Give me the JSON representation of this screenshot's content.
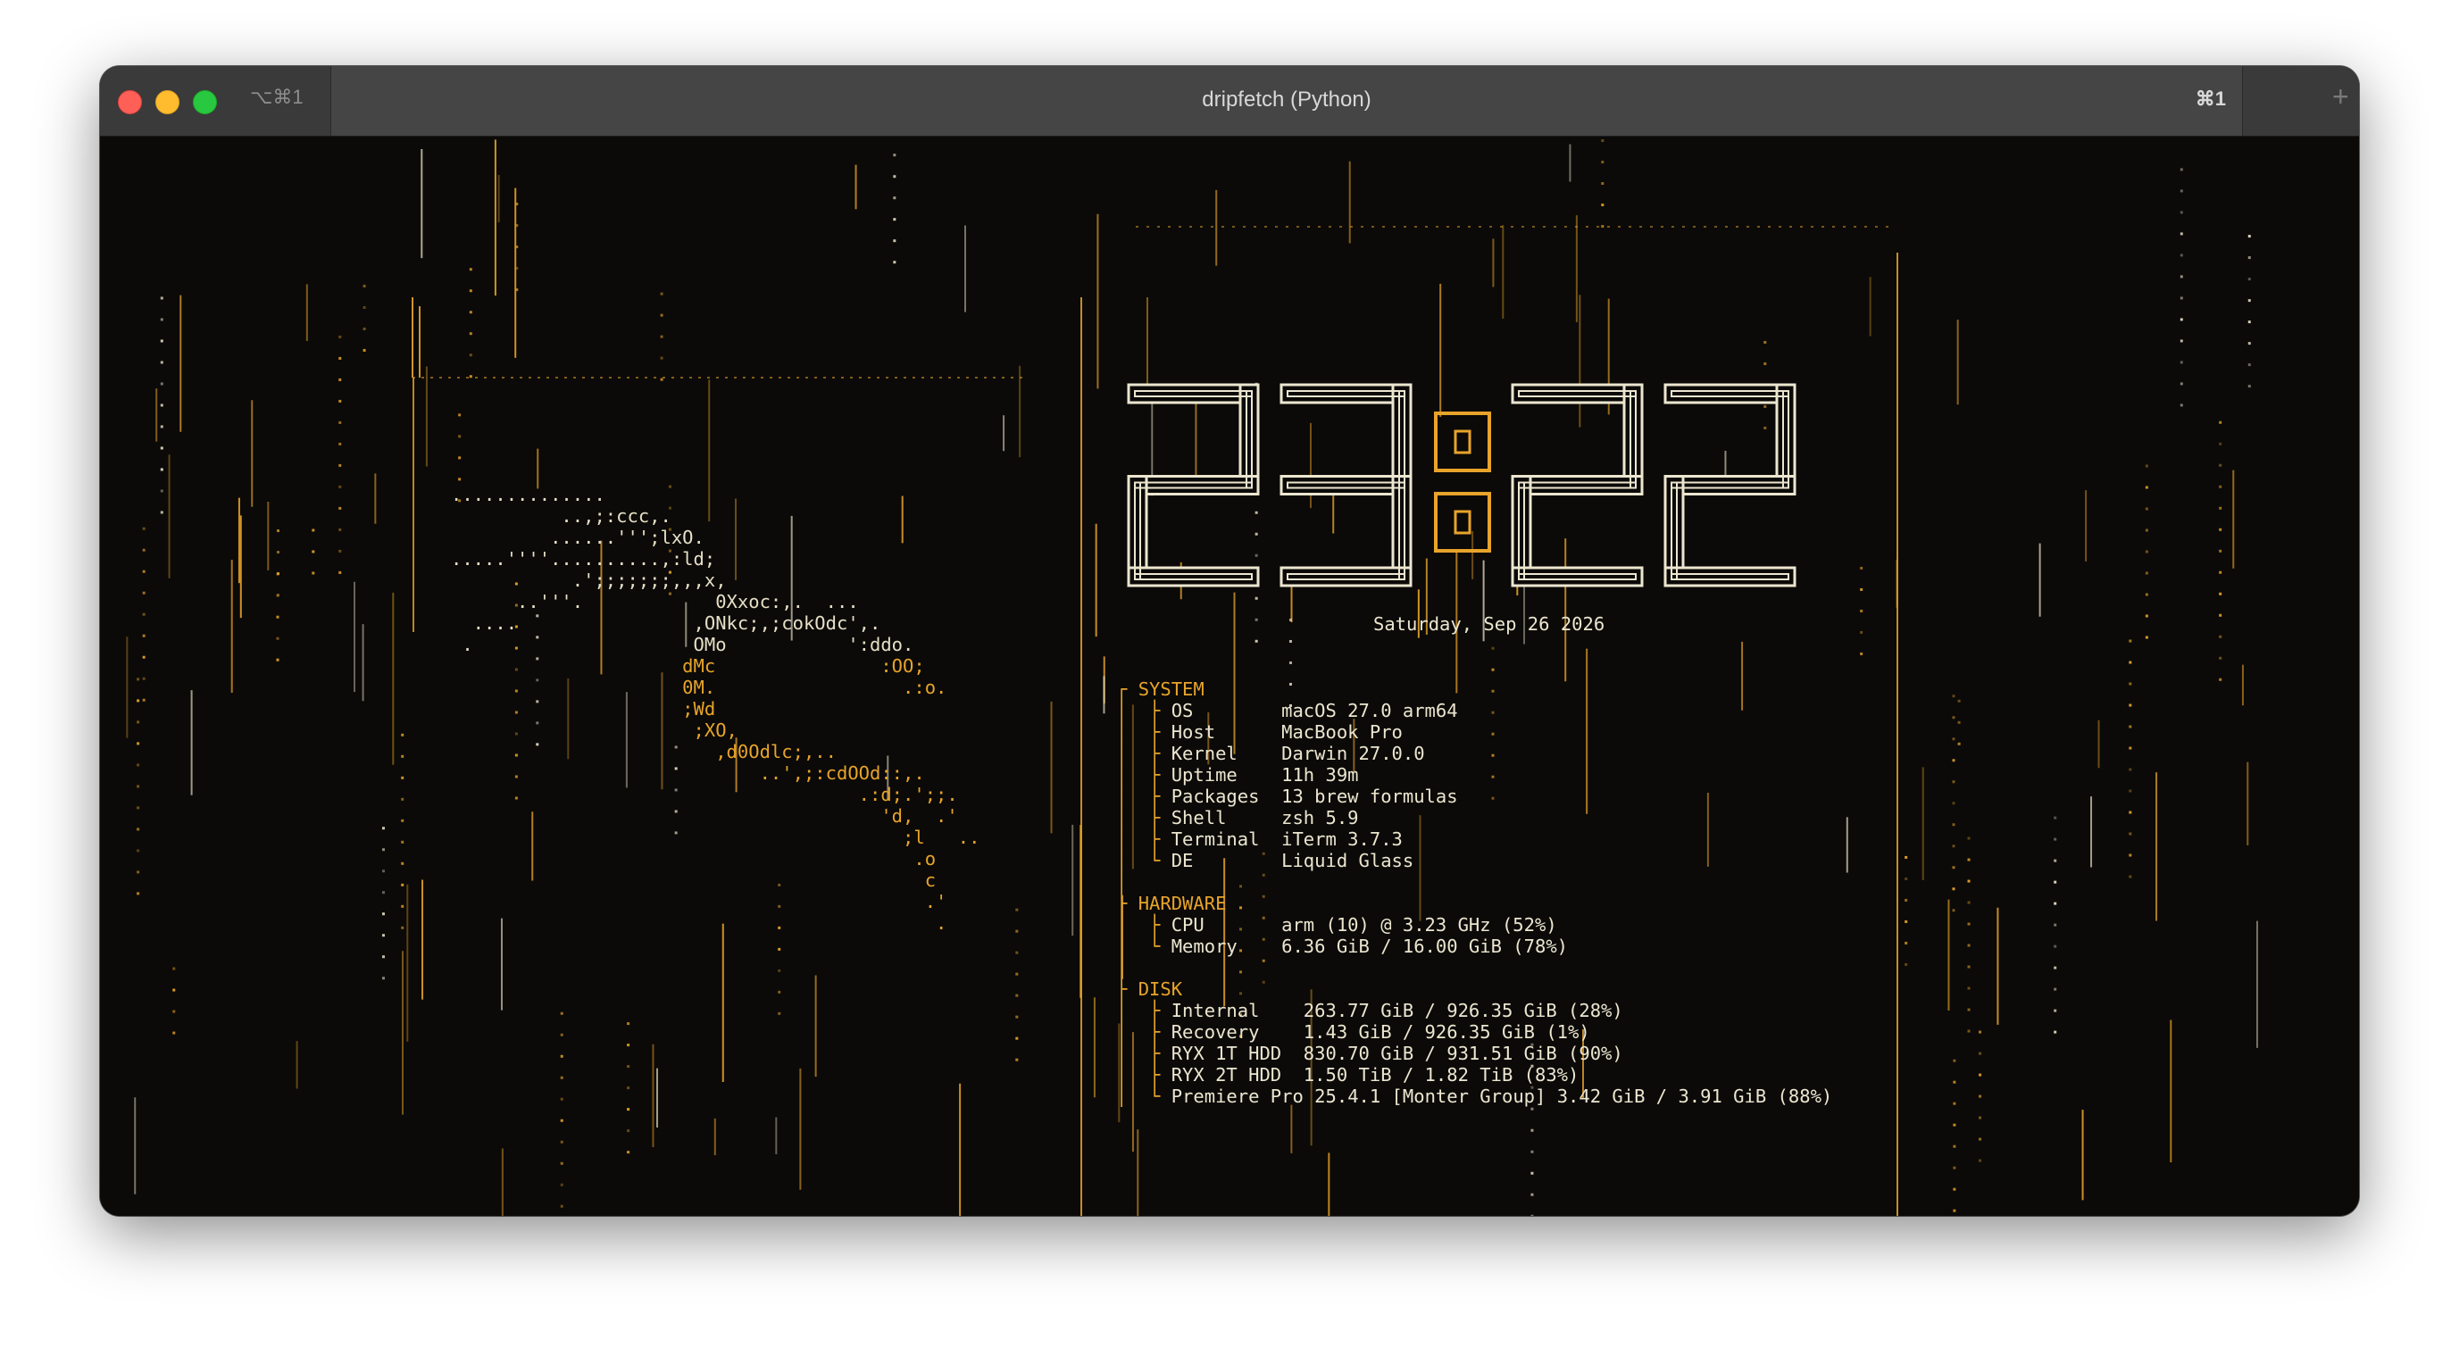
{
  "window": {
    "title": "dripfetch (Python)",
    "left_shortcut": "⌥⌘1",
    "right_shortcut": "⌘1",
    "new_tab_label": "+"
  },
  "colors": {
    "accent": "#e8a42a",
    "text": "#ece6d0",
    "background": "#0b0a08"
  },
  "clock": {
    "time": "23:22"
  },
  "date": "Saturday, Sep 26 2026",
  "ascii_art": [
    {
      "text": "..............",
      "amber": false
    },
    {
      "text": "          ..,;:ccc,.",
      "amber": false
    },
    {
      "text": "         ......''';lxO.",
      "amber": false
    },
    {
      "text": ".....''''..........,:ld;",
      "amber": false
    },
    {
      "text": "           .';;;;;;;,,,x,",
      "amber": false
    },
    {
      "text": "      ..'''.            0Xxoc:,.  ...",
      "amber": false
    },
    {
      "text": "  ....                ,ONkc;,;cokOdc',.",
      "amber": false
    },
    {
      "text": " .                    OMo           ':ddo.",
      "amber": false
    },
    {
      "text": "                     dMc               :OO;",
      "amber": true
    },
    {
      "text": "                     0M.                 .:o.",
      "amber": true
    },
    {
      "text": "                     ;Wd",
      "amber": true
    },
    {
      "text": "                      ;XO,",
      "amber": true
    },
    {
      "text": "                        ,d0Odlc;,..",
      "amber": true
    },
    {
      "text": "                            ..',;:cdOOd::,.",
      "amber": true
    },
    {
      "text": "                                     .:d;.';;.",
      "amber": true
    },
    {
      "text": "                                       'd,  .'",
      "amber": true
    },
    {
      "text": "                                         ;l   ..",
      "amber": true
    },
    {
      "text": "                                          .o",
      "amber": true
    },
    {
      "text": "                                           c",
      "amber": true
    },
    {
      "text": "                                           .'",
      "amber": true
    },
    {
      "text": "                                            .",
      "amber": true
    }
  ],
  "sections": [
    {
      "title": "SYSTEM",
      "items": [
        {
          "key": "OS",
          "value": "macOS 27.0 arm64"
        },
        {
          "key": "Host",
          "value": "MacBook Pro"
        },
        {
          "key": "Kernel",
          "value": "Darwin 27.0.0"
        },
        {
          "key": "Uptime",
          "value": "11h 39m"
        },
        {
          "key": "Packages",
          "value": "13 brew formulas"
        },
        {
          "key": "Shell",
          "value": "zsh 5.9"
        },
        {
          "key": "Terminal",
          "value": "iTerm 3.7.3"
        },
        {
          "key": "DE",
          "value": "Liquid Glass"
        }
      ]
    },
    {
      "title": "HARDWARE",
      "items": [
        {
          "key": "CPU",
          "value": "arm (10) @ 3.23 GHz (52%)"
        },
        {
          "key": "Memory",
          "value": "6.36 GiB / 16.00 GiB (78%)"
        }
      ]
    },
    {
      "title": "DISK",
      "items": [
        {
          "key": "Internal",
          "value": "263.77 GiB / 926.35 GiB (28%)"
        },
        {
          "key": "Recovery",
          "value": "1.43 GiB / 926.35 GiB (1%)"
        },
        {
          "key": "RYX 1T HDD",
          "value": "830.70 GiB / 931.51 GiB (90%)"
        },
        {
          "key": "RYX 2T HDD",
          "value": "1.50 TiB / 1.82 TiB (83%)"
        },
        {
          "key": "Premiere Pro 25.4.1 [Monter Group]",
          "value": "3.42 GiB / 3.91 GiB (88%)"
        }
      ]
    }
  ]
}
